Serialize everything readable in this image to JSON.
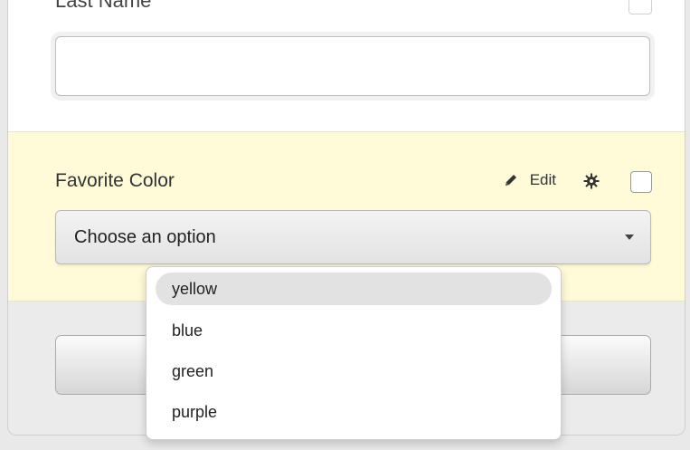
{
  "form": {
    "last_name_field": {
      "label": "Last Name",
      "value": ""
    },
    "favorite_color_field": {
      "label": "Favorite Color",
      "edit_label": "Edit",
      "select_placeholder": "Choose an option",
      "options": [
        "yellow",
        "blue",
        "green",
        "purple"
      ],
      "highlighted_option": "yellow"
    },
    "footer_button": {
      "label": ""
    }
  },
  "icons": {
    "edit": "pencil-icon",
    "settings": "gear-icon",
    "select_arrow": "caret-down-icon"
  },
  "colors": {
    "active_section_bg": "#fffbd9",
    "option_highlight": "#e2e2e2"
  }
}
